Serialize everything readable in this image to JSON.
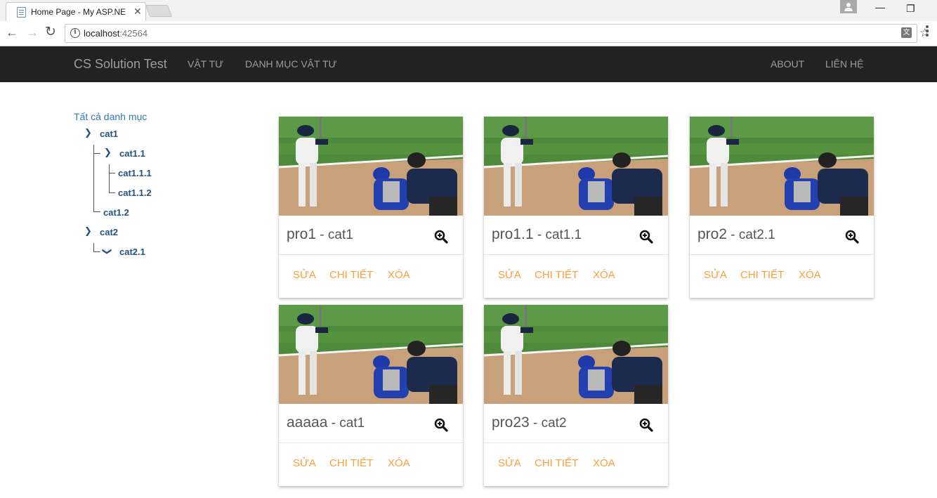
{
  "browser": {
    "tab_title": "Home Page - My ASP.NE",
    "url_host": "localhost",
    "url_port": ":42564"
  },
  "navbar": {
    "brand": "CS Solution Test",
    "left_links": [
      "VẬT TƯ",
      "DANH MỤC VẬT TƯ"
    ],
    "right_links": [
      "ABOUT",
      "LIÊN HỆ"
    ]
  },
  "tree": {
    "root": "Tất cả danh mục",
    "items": [
      {
        "label": "cat1",
        "icon": "chevron-right-icon"
      },
      {
        "label": "cat1.1",
        "icon": "chevron-right-icon"
      },
      {
        "label": "cat1.1.1"
      },
      {
        "label": "cat1.1.2"
      },
      {
        "label": "cat1.2"
      },
      {
        "label": "cat2",
        "icon": "chevron-right-icon"
      },
      {
        "label": "cat2.1",
        "icon": "chevron-down-icon"
      }
    ]
  },
  "products": [
    {
      "name": "pro1",
      "category": "cat1"
    },
    {
      "name": "pro1.1",
      "category": "cat1.1"
    },
    {
      "name": "pro2",
      "category": "cat2.1"
    },
    {
      "name": "aaaaa",
      "category": "cat1"
    },
    {
      "name": "pro23",
      "category": "cat2"
    }
  ],
  "card_actions": {
    "edit": "SỬA",
    "details": "CHI TIẾT",
    "delete": "XÓA"
  },
  "separator": " - ",
  "colors": {
    "navbar_bg": "#222222",
    "action": "#ff9e3d",
    "tree_link": "#23527c",
    "root_link": "#337ab7"
  }
}
